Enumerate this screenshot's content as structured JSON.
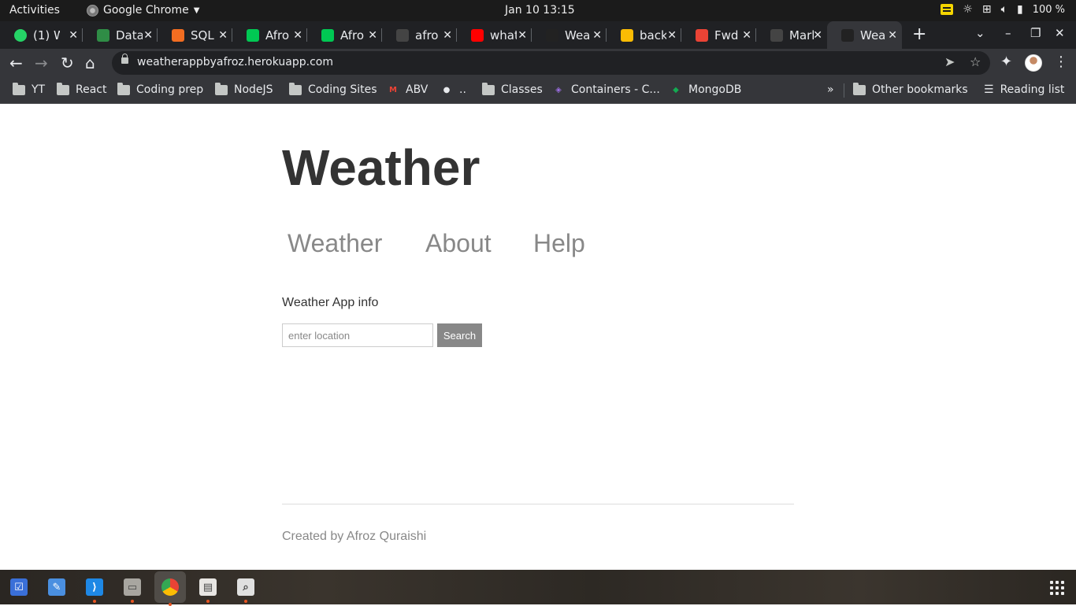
{
  "system": {
    "activities": "Activities",
    "app_menu": "Google Chrome",
    "clock": "Jan 10  13:15",
    "battery": "100 %"
  },
  "tabs": [
    {
      "label": "(1) W",
      "favicon": "whatsapp-icon",
      "color": "#25d366"
    },
    {
      "label": "Data",
      "favicon": "geeksforgeeks-icon",
      "color": "#2f8d46"
    },
    {
      "label": "SQL",
      "favicon": "sqlbolt-icon",
      "color": "#f26d21"
    },
    {
      "label": "Afro",
      "favicon": "mongoose-leaf-icon",
      "color": "#00c853"
    },
    {
      "label": "Afro",
      "favicon": "mongoose-leaf-icon",
      "color": "#00c853"
    },
    {
      "label": "afro",
      "favicon": "github-icon",
      "color": "#444"
    },
    {
      "label": "what",
      "favicon": "youtube-icon",
      "color": "#ff0000"
    },
    {
      "label": "Wea",
      "favicon": "weather-icon",
      "color": "#222"
    },
    {
      "label": "back",
      "favicon": "google-drive-icon",
      "color": "#fbbc04"
    },
    {
      "label": "Fwd",
      "favicon": "gmail-icon",
      "color": "#ea4335"
    },
    {
      "label": "Marl",
      "favicon": "github-icon",
      "color": "#444"
    },
    {
      "label": "Wea",
      "favicon": "weather-icon",
      "color": "#222",
      "active": true
    }
  ],
  "omnibox": {
    "url": "weatherappbyafroz.herokuapp.com"
  },
  "bookmarks": [
    {
      "label": "YT",
      "type": "folder"
    },
    {
      "label": "React",
      "type": "folder"
    },
    {
      "label": "Coding prep",
      "type": "folder"
    },
    {
      "label": "NodeJS",
      "type": "folder"
    },
    {
      "label": "Coding Sites",
      "type": "folder"
    },
    {
      "label": "ABV",
      "type": "gmail"
    },
    {
      "label": "..",
      "type": "github"
    },
    {
      "label": "Classes",
      "type": "folder"
    },
    {
      "label": "Containers - C...",
      "type": "containers"
    },
    {
      "label": "MongoDB",
      "type": "mongodb"
    }
  ],
  "bookmarks_overflow": "»",
  "other_bookmarks": "Other bookmarks",
  "reading_list": "Reading list",
  "page": {
    "title": "Weather",
    "nav": [
      "Weather",
      "About",
      "Help"
    ],
    "info": "Weather App info",
    "location_placeholder": "enter location",
    "search_label": "Search",
    "footer": "Created by Afroz Quraishi"
  },
  "dock": [
    {
      "name": "tasks-app-icon",
      "color": "#3a6fd8"
    },
    {
      "name": "text-editor-icon",
      "color": "#4a8fe0"
    },
    {
      "name": "vscode-icon",
      "color": "#1e88e5",
      "running": true
    },
    {
      "name": "files-icon",
      "color": "#a8a6a0",
      "running": true
    },
    {
      "name": "chrome-icon",
      "color": "#fbbc04",
      "running": true,
      "active": true
    },
    {
      "name": "document-viewer-icon",
      "color": "#e8e6e3",
      "running": true
    },
    {
      "name": "image-viewer-icon",
      "color": "#e0e0e0",
      "running": true
    }
  ]
}
